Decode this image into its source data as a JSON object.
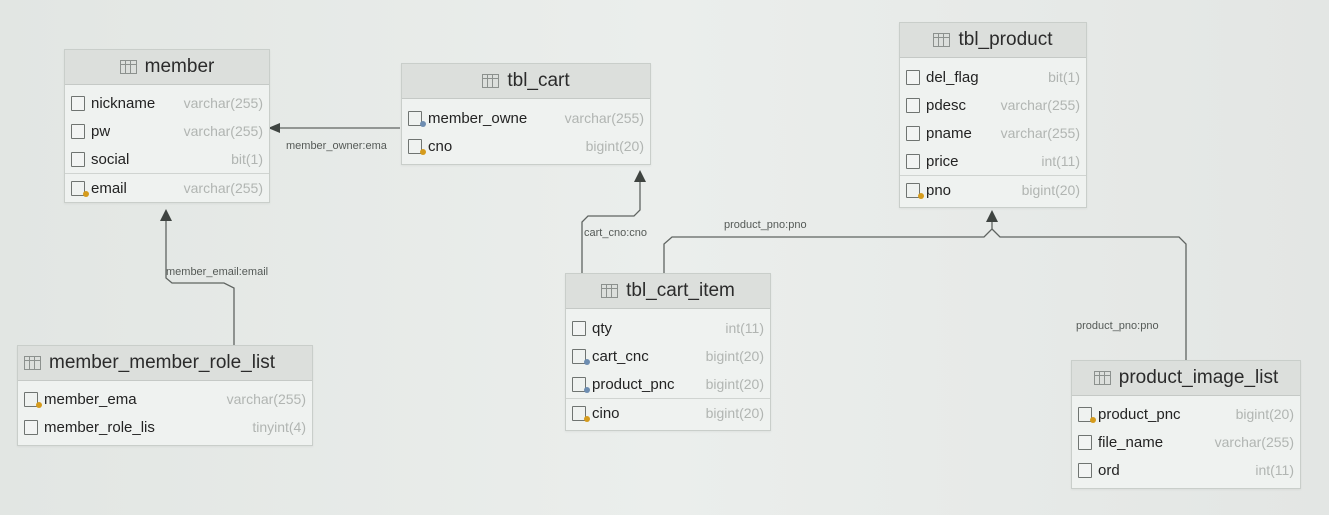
{
  "tables": {
    "member": {
      "name": "member",
      "columns": [
        {
          "name": "nickname",
          "type": "varchar(255)"
        },
        {
          "name": "pw",
          "type": "varchar(255)"
        },
        {
          "name": "social",
          "type": "bit(1)"
        },
        {
          "name": "email",
          "type": "varchar(255)"
        }
      ]
    },
    "tbl_cart": {
      "name": "tbl_cart",
      "columns": [
        {
          "name": "member_owne",
          "type": "varchar(255)"
        },
        {
          "name": "cno",
          "type": "bigint(20)"
        }
      ]
    },
    "tbl_product": {
      "name": "tbl_product",
      "columns": [
        {
          "name": "del_flag",
          "type": "bit(1)"
        },
        {
          "name": "pdesc",
          "type": "varchar(255)"
        },
        {
          "name": "pname",
          "type": "varchar(255)"
        },
        {
          "name": "price",
          "type": "int(11)"
        },
        {
          "name": "pno",
          "type": "bigint(20)"
        }
      ]
    },
    "tbl_cart_item": {
      "name": "tbl_cart_item",
      "columns": [
        {
          "name": "qty",
          "type": "int(11)"
        },
        {
          "name": "cart_cnc",
          "type": "bigint(20)"
        },
        {
          "name": "product_pnc",
          "type": "bigint(20)"
        },
        {
          "name": "cino",
          "type": "bigint(20)"
        }
      ]
    },
    "member_member_role_list": {
      "name": "member_member_role_list",
      "columns": [
        {
          "name": "member_ema",
          "type": "varchar(255)"
        },
        {
          "name": "member_role_lis",
          "type": "tinyint(4)"
        }
      ]
    },
    "product_image_list": {
      "name": "product_image_list",
      "columns": [
        {
          "name": "product_pnc",
          "type": "bigint(20)"
        },
        {
          "name": "file_name",
          "type": "varchar(255)"
        },
        {
          "name": "ord",
          "type": "int(11)"
        }
      ]
    }
  },
  "relations": {
    "cart_member": "member_owner:ema",
    "role_member": "member_email:email",
    "item_cart": "cart_cno:cno",
    "item_product": "product_pno:pno",
    "image_product": "product_pno:pno"
  },
  "colors": {
    "line": "#5f6461",
    "header": "#dcdfdc",
    "table_bg": "#eff2f0",
    "type_text": "#b1b5b2",
    "pk_key": "#d59b1c",
    "fk_key": "#6d8db1"
  }
}
